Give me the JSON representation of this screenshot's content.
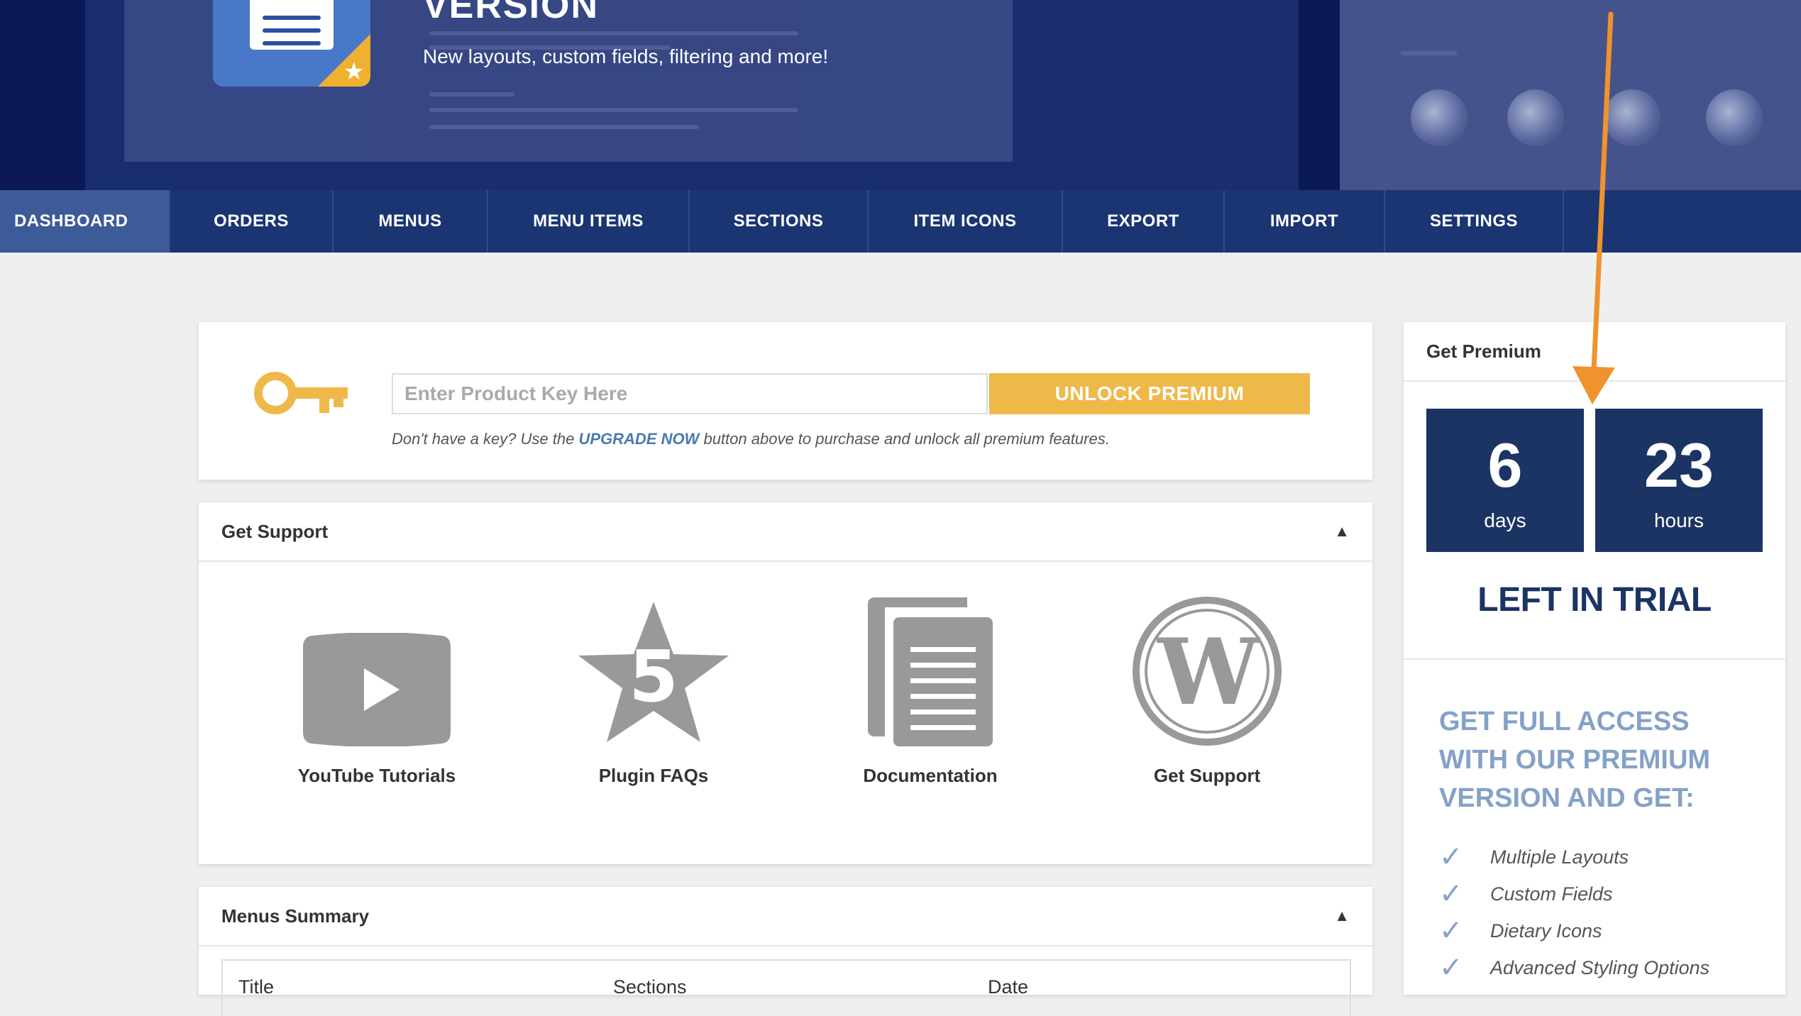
{
  "banner": {
    "title": "VERSION",
    "subtitle": "New layouts, custom fields, filtering and more!"
  },
  "nav": {
    "items": [
      "DASHBOARD",
      "ORDERS",
      "MENUS",
      "MENU ITEMS",
      "SECTIONS",
      "ITEM ICONS",
      "EXPORT",
      "IMPORT",
      "SETTINGS"
    ],
    "active": "DASHBOARD"
  },
  "product_key": {
    "placeholder": "Enter Product Key Here",
    "button_label": "UNLOCK PREMIUM",
    "help_prefix": "Don't have a key? Use the ",
    "help_highlight": "UPGRADE NOW",
    "help_suffix": " button above to purchase and unlock all premium features."
  },
  "support": {
    "title": "Get Support",
    "items": [
      "YouTube Tutorials",
      "Plugin FAQs",
      "Documentation",
      "Get Support"
    ],
    "faq_number": "5"
  },
  "menus_summary": {
    "title": "Menus Summary",
    "columns": [
      "Title",
      "Sections",
      "Date"
    ]
  },
  "premium": {
    "title": "Get Premium",
    "days_value": "6",
    "days_label": "days",
    "hours_value": "23",
    "hours_label": "hours",
    "trial_label": "LEFT IN TRIAL",
    "promo_text": "GET FULL ACCESS WITH OUR PREMIUM VERSION AND GET:",
    "features": [
      "Multiple Layouts",
      "Custom Fields",
      "Dietary Icons",
      "Advanced Styling Options"
    ]
  },
  "colors": {
    "nav_bg": "#1b3573",
    "accent": "#efb94a",
    "navy": "#1c3464",
    "promo_blue": "#85a1c7",
    "arrow": "#f0922e"
  },
  "icons": {
    "key": "key-icon",
    "youtube": "youtube-play-icon",
    "faq": "star-icon",
    "docs": "documents-icon",
    "wordpress": "wordpress-icon",
    "check": "checkmark-icon",
    "collapse": "triangle-up-icon"
  }
}
